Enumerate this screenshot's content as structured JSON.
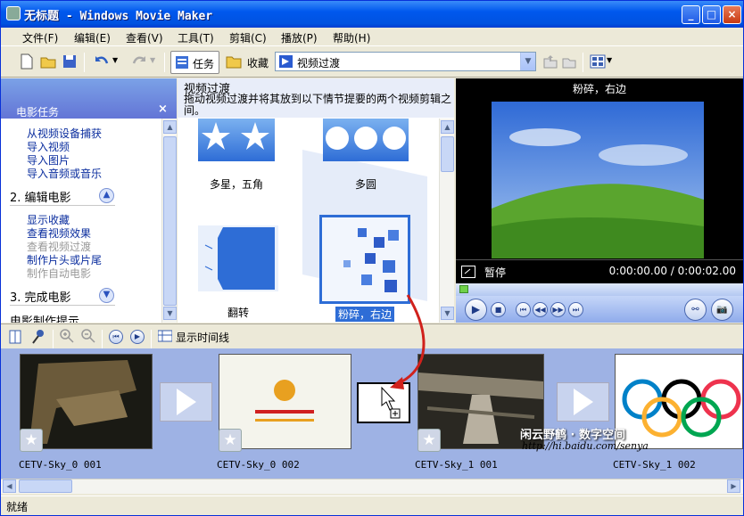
{
  "window": {
    "title": "无标题 - Windows Movie Maker"
  },
  "menu": [
    "文件(F)",
    "编辑(E)",
    "查看(V)",
    "工具(T)",
    "剪辑(C)",
    "播放(P)",
    "帮助(H)"
  ],
  "toolbar": {
    "tasks_label": "任务",
    "collections_label": "收藏",
    "combo_value": "视频过渡"
  },
  "taskpane": {
    "title": "电影任务",
    "close": "×",
    "capture_links": [
      "从视频设备捕获",
      "导入视频",
      "导入图片",
      "导入音频或音乐"
    ],
    "edit_section": "2. 编辑电影",
    "edit_links": [
      "显示收藏",
      "查看视频效果",
      "查看视频过渡",
      "制作片头或片尾",
      "制作自动电影"
    ],
    "finish_section": "3. 完成电影",
    "tips_section": "电影制作提示"
  },
  "content": {
    "title": "视频过渡",
    "description": "拖动视频过渡并将其放到以下情节提要的两个视频剪辑之间。",
    "transitions": [
      "多星，五角",
      "多圆",
      "翻转",
      "粉碎，右边"
    ]
  },
  "preview": {
    "caption": "粉碎，右边",
    "state": "暂停",
    "time": "0:00:00.00 / 0:00:02.00"
  },
  "storyboard": {
    "show_timeline": "显示时间线",
    "clips": [
      "CETV-Sky_0 001",
      "CETV-Sky_0 002",
      "CETV-Sky_1 001",
      "CETV-Sky_1 002"
    ]
  },
  "watermark": {
    "line1": "闲云野鹤 · 数字空间",
    "line2": "http://hi.baidu.com/senya"
  },
  "status": "就绪",
  "colors": {
    "title_blue": "#0058ee",
    "task_link": "#0a2d9e",
    "drag_arrow": "#d0211c"
  }
}
